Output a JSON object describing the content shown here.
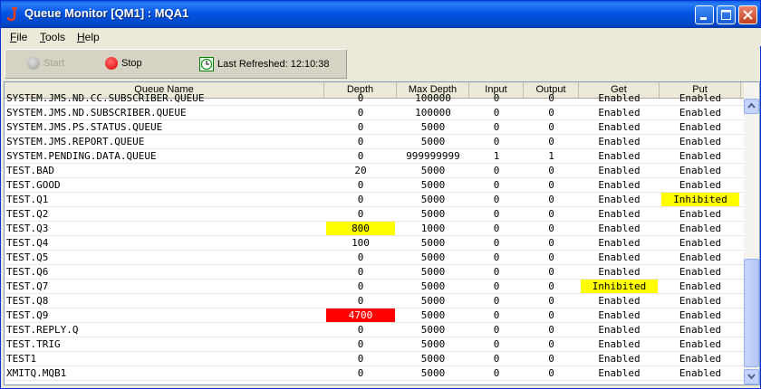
{
  "window": {
    "title": "Queue Monitor [QM1] : MQA1",
    "icons": {
      "app": "app-j-icon",
      "minimize": "minimize-icon",
      "maximize": "maximize-icon",
      "close": "close-icon"
    }
  },
  "menu": [
    {
      "accel": "F",
      "rest": "ile"
    },
    {
      "accel": "T",
      "rest": "ools"
    },
    {
      "accel": "H",
      "rest": "elp"
    }
  ],
  "toolbar": {
    "start_label": "Start",
    "stop_label": "Stop",
    "refreshed_label": "Last Refreshed: 12:10:38",
    "icons": {
      "start": "start-grey-dot-icon",
      "stop": "stop-red-dot-icon",
      "refresh": "clock-icon"
    }
  },
  "columns": [
    "Queue Name",
    "Depth",
    "Max Depth",
    "Input",
    "Output",
    "Get",
    "Put"
  ],
  "rows": [
    {
      "name": "SYSTEM.JMS.ND.CC.SUBSCRIBER.QUEUE",
      "depth": "0",
      "max": "100000",
      "input": "0",
      "output": "0",
      "get": "Enabled",
      "put": "Enabled"
    },
    {
      "name": "SYSTEM.JMS.ND.SUBSCRIBER.QUEUE",
      "depth": "0",
      "max": "100000",
      "input": "0",
      "output": "0",
      "get": "Enabled",
      "put": "Enabled"
    },
    {
      "name": "SYSTEM.JMS.PS.STATUS.QUEUE",
      "depth": "0",
      "max": "5000",
      "input": "0",
      "output": "0",
      "get": "Enabled",
      "put": "Enabled"
    },
    {
      "name": "SYSTEM.JMS.REPORT.QUEUE",
      "depth": "0",
      "max": "5000",
      "input": "0",
      "output": "0",
      "get": "Enabled",
      "put": "Enabled"
    },
    {
      "name": "SYSTEM.PENDING.DATA.QUEUE",
      "depth": "0",
      "max": "999999999",
      "input": "1",
      "output": "1",
      "get": "Enabled",
      "put": "Enabled"
    },
    {
      "name": "TEST.BAD",
      "depth": "20",
      "max": "5000",
      "input": "0",
      "output": "0",
      "get": "Enabled",
      "put": "Enabled"
    },
    {
      "name": "TEST.GOOD",
      "depth": "0",
      "max": "5000",
      "input": "0",
      "output": "0",
      "get": "Enabled",
      "put": "Enabled"
    },
    {
      "name": "TEST.Q1",
      "depth": "0",
      "max": "5000",
      "input": "0",
      "output": "0",
      "get": "Enabled",
      "put": "Inhibited",
      "put_hl": "yellow"
    },
    {
      "name": "TEST.Q2",
      "depth": "0",
      "max": "5000",
      "input": "0",
      "output": "0",
      "get": "Enabled",
      "put": "Enabled"
    },
    {
      "name": "TEST.Q3",
      "depth": "800",
      "max": "1000",
      "input": "0",
      "output": "0",
      "get": "Enabled",
      "put": "Enabled",
      "depth_hl": "yellow"
    },
    {
      "name": "TEST.Q4",
      "depth": "100",
      "max": "5000",
      "input": "0",
      "output": "0",
      "get": "Enabled",
      "put": "Enabled"
    },
    {
      "name": "TEST.Q5",
      "depth": "0",
      "max": "5000",
      "input": "0",
      "output": "0",
      "get": "Enabled",
      "put": "Enabled"
    },
    {
      "name": "TEST.Q6",
      "depth": "0",
      "max": "5000",
      "input": "0",
      "output": "0",
      "get": "Enabled",
      "put": "Enabled"
    },
    {
      "name": "TEST.Q7",
      "depth": "0",
      "max": "5000",
      "input": "0",
      "output": "0",
      "get": "Inhibited",
      "put": "Enabled",
      "get_hl": "yellow"
    },
    {
      "name": "TEST.Q8",
      "depth": "0",
      "max": "5000",
      "input": "0",
      "output": "0",
      "get": "Enabled",
      "put": "Enabled"
    },
    {
      "name": "TEST.Q9",
      "depth": "4700",
      "max": "5000",
      "input": "0",
      "output": "0",
      "get": "Enabled",
      "put": "Enabled",
      "depth_hl": "red"
    },
    {
      "name": "TEST.REPLY.Q",
      "depth": "0",
      "max": "5000",
      "input": "0",
      "output": "0",
      "get": "Enabled",
      "put": "Enabled"
    },
    {
      "name": "TEST.TRIG",
      "depth": "0",
      "max": "5000",
      "input": "0",
      "output": "0",
      "get": "Enabled",
      "put": "Enabled"
    },
    {
      "name": "TEST1",
      "depth": "0",
      "max": "5000",
      "input": "0",
      "output": "0",
      "get": "Enabled",
      "put": "Enabled"
    },
    {
      "name": "XMITQ.MQB1",
      "depth": "0",
      "max": "5000",
      "input": "0",
      "output": "0",
      "get": "Enabled",
      "put": "Enabled"
    }
  ],
  "scrollbar": {
    "up_icon": "scroll-up-arrow-icon",
    "down_icon": "scroll-down-arrow-icon"
  },
  "colors": {
    "warning": "#ffff00",
    "alert": "#ff0000",
    "titlebar": "#0054e3"
  }
}
